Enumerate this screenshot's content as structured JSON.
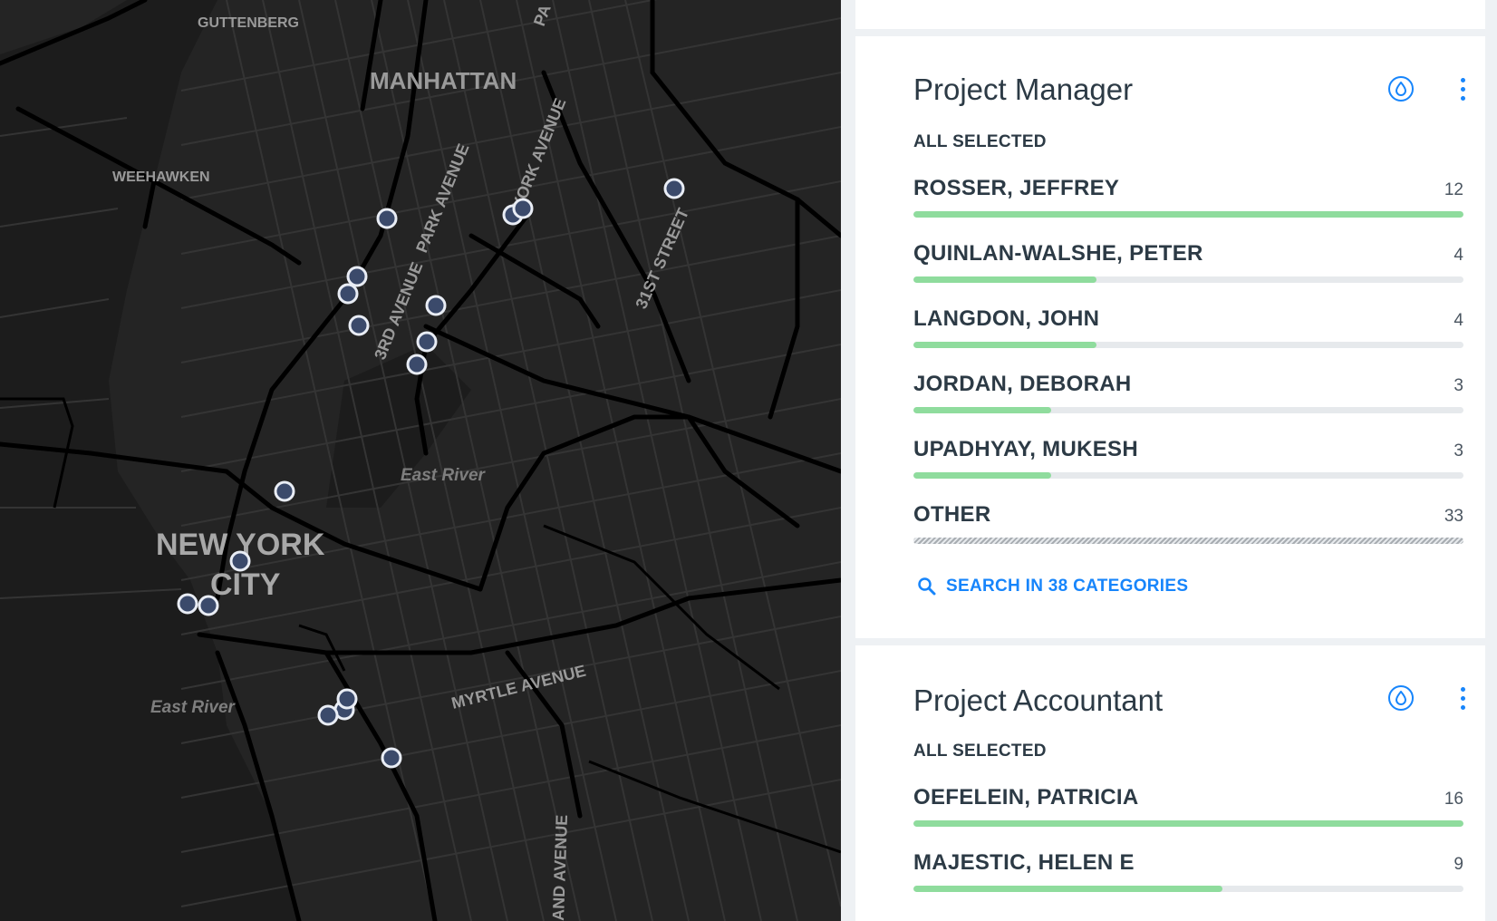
{
  "map": {
    "labels": {
      "guttenberg": "GUTTENBERG",
      "manhattan": "MANHATTAN",
      "weehawken": "WEEHAWKEN",
      "park_avenue": "PARK AVENUE",
      "york_avenue": "YORK AVENUE",
      "third_avenue": "3RD AVENUE",
      "st31": "31ST STREET",
      "east_river_1": "East River",
      "east_river_2": "East River",
      "nyc_line1": "NEW YORK",
      "nyc_line2": "CITY",
      "myrtle": "MYRTLE AVENUE",
      "pa_partial": "PA",
      "and_avenue": "AND AVENUE"
    },
    "colors": {
      "background": "#242424",
      "road": "#000000",
      "minor_road": "#3a3a3a",
      "water": "#1b1b1b",
      "marker_fill": "#3b4a6b",
      "marker_stroke": "#e9edf5"
    }
  },
  "widgets": [
    {
      "title": "Project Manager",
      "selection_status": "ALL SELECTED",
      "icons": [
        "color-drop-icon",
        "more-vert-icon"
      ],
      "rows": [
        {
          "name": "ROSSER, JEFFREY",
          "count": "12",
          "fraction": 1.0
        },
        {
          "name": "QUINLAN-WALSHE, PETER",
          "count": "4",
          "fraction": 0.333
        },
        {
          "name": "LANGDON, JOHN",
          "count": "4",
          "fraction": 0.333
        },
        {
          "name": "JORDAN, DEBORAH",
          "count": "3",
          "fraction": 0.25
        },
        {
          "name": "UPADHYAY, MUKESH",
          "count": "3",
          "fraction": 0.25
        },
        {
          "name": "OTHER",
          "count": "33",
          "fraction": 1.0,
          "other": true
        }
      ],
      "search_label": "SEARCH IN 38 CATEGORIES"
    },
    {
      "title": "Project Accountant",
      "selection_status": "ALL SELECTED",
      "icons": [
        "color-drop-icon",
        "more-vert-icon"
      ],
      "rows": [
        {
          "name": "OEFELEIN, PATRICIA",
          "count": "16",
          "fraction": 1.0
        },
        {
          "name": "MAJESTIC, HELEN E",
          "count": "9",
          "fraction": 0.5625
        }
      ]
    }
  ],
  "colors": {
    "accent": "#1785fb",
    "bar_fill": "#8fdc9d",
    "bar_track": "#e6e9ec",
    "text": "#2c3a45"
  }
}
